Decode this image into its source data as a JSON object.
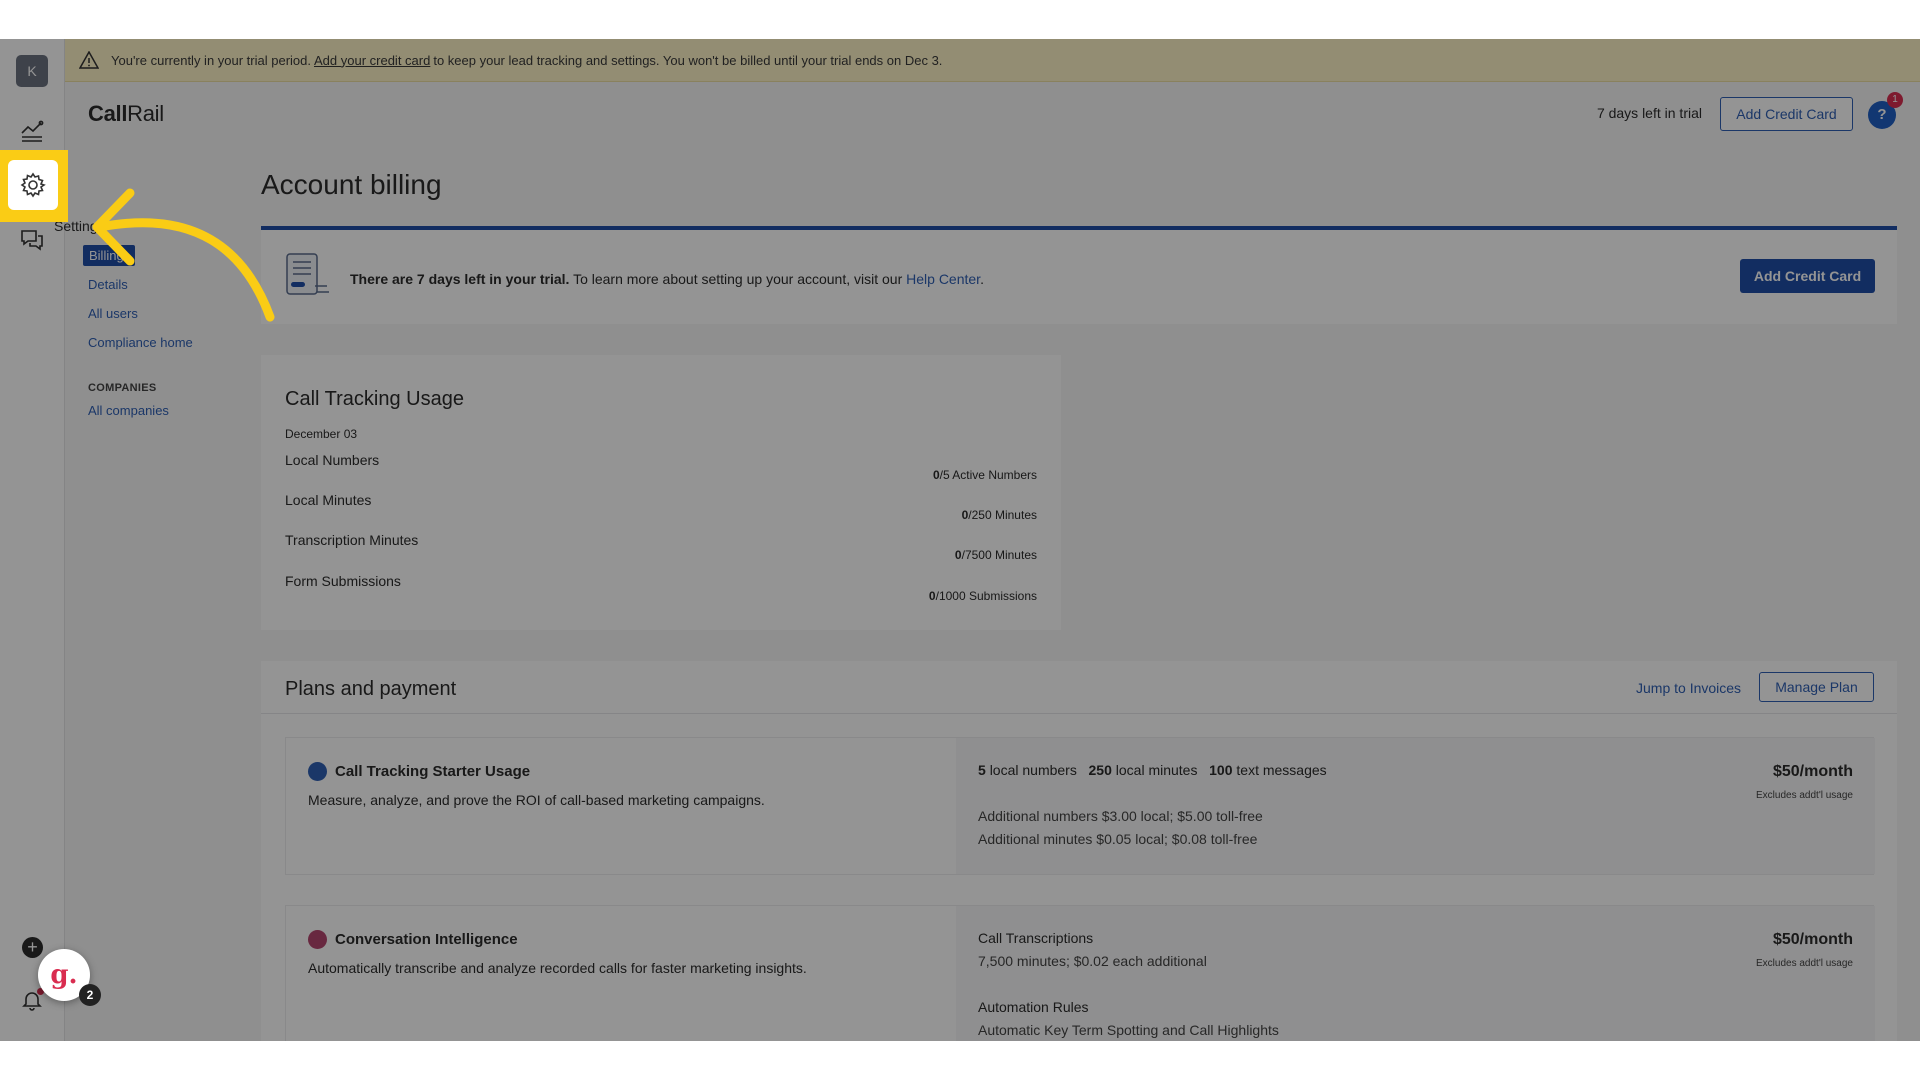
{
  "banner": {
    "prefix": "You're currently in your trial period.",
    "link": "Add your credit card",
    "suffix": "to keep your lead tracking and settings. You won't be billed until your trial ends on Dec 3."
  },
  "rail": {
    "avatar_letter": "K",
    "widget_letter": "g.",
    "widget_badge": "2"
  },
  "header": {
    "brand_a": "Call",
    "brand_b": "Rail",
    "trial_days": "7 days left in trial",
    "add_card_label": "Add Credit Card",
    "help_glyph": "?",
    "help_badge": "1"
  },
  "nav": {
    "settings_label": "Settings",
    "items": [
      "Billing",
      "Details",
      "All users",
      "Compliance home"
    ],
    "companies_heading": "COMPANIES",
    "companies_items": [
      "All companies"
    ]
  },
  "page": {
    "title": "Account billing"
  },
  "info": {
    "bold": "There are 7 days left in your trial.",
    "text": "To learn more about setting up your account, visit our",
    "link": "Help Center",
    "period": ".",
    "button": "Add Credit Card"
  },
  "usage": {
    "title": "Call Tracking Usage",
    "date": "December 03",
    "rows": [
      {
        "label": "Local Numbers",
        "used": "0",
        "limit": "/5 Active Numbers"
      },
      {
        "label": "Local Minutes",
        "used": "0",
        "limit": "/250 Minutes"
      },
      {
        "label": "Transcription Minutes",
        "used": "0",
        "limit": "/7500 Minutes"
      },
      {
        "label": "Form Submissions",
        "used": "0",
        "limit": "/1000 Submissions"
      }
    ]
  },
  "plans": {
    "title": "Plans and payment",
    "jump": "Jump to Invoices",
    "manage": "Manage Plan",
    "items": [
      {
        "name": "Call Tracking Starter Usage",
        "desc": "Measure, analyze, and prove the ROI of call-based marketing campaigns.",
        "price": "$50/month",
        "excl": "Excludes addt'l usage",
        "q1": "5",
        "q1l": "local numbers",
        "q2": "250",
        "q2l": "local minutes",
        "q3": "100",
        "q3l": "text messages",
        "line1": "Additional numbers $3.00 local; $5.00 toll-free",
        "line2": "Additional minutes $0.05 local; $0.08 toll-free"
      },
      {
        "name": "Conversation Intelligence",
        "desc": "Automatically transcribe and analyze recorded calls for faster marketing insights.",
        "price": "$50/month",
        "excl": "Excludes addt'l usage",
        "f1": "Call Transcriptions",
        "f1s": "7,500 minutes; $0.02 each additional",
        "f2": "Automation Rules",
        "f2s": "Automatic Key Term Spotting and Call Highlights"
      }
    ]
  },
  "colors": {
    "accent": "#1f4fa8",
    "link": "#2f5fb3",
    "highlight": "#facc15",
    "banner_bg": "#fdf3c7"
  }
}
